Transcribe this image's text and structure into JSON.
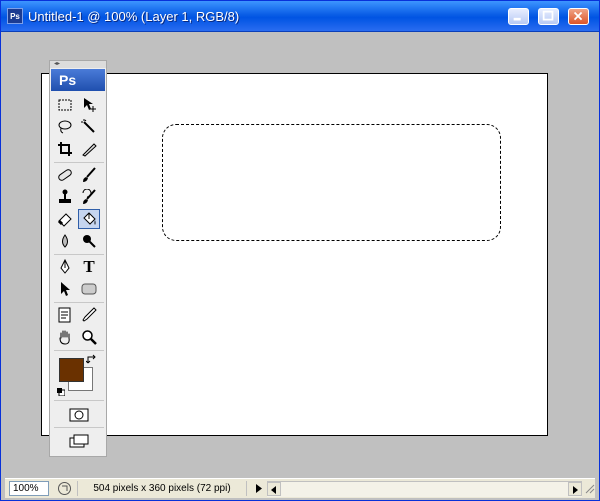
{
  "window": {
    "title": "Untitled-1 @ 100% (Layer 1, RGB/8)",
    "icon": "photoshop-icon",
    "icon_text": "Ps",
    "buttons": [
      "minimize-icon",
      "maximize-icon",
      "close-icon"
    ]
  },
  "toolbox": {
    "logo": "Ps",
    "tools": [
      {
        "name": "rectangular-marquee-tool",
        "icon": "marquee-icon"
      },
      {
        "name": "move-tool",
        "icon": "move-icon"
      },
      {
        "name": "lasso-tool",
        "icon": "lasso-icon"
      },
      {
        "name": "magic-wand-tool",
        "icon": "magic-wand-icon"
      },
      {
        "name": "crop-tool",
        "icon": "crop-icon"
      },
      {
        "name": "slice-tool",
        "icon": "slice-icon"
      },
      {
        "name": "healing-brush-tool",
        "icon": "bandage-icon"
      },
      {
        "name": "brush-tool",
        "icon": "brush-icon"
      },
      {
        "name": "clone-stamp-tool",
        "icon": "stamp-icon"
      },
      {
        "name": "history-brush-tool",
        "icon": "history-brush-icon"
      },
      {
        "name": "eraser-tool",
        "icon": "eraser-icon"
      },
      {
        "name": "paint-bucket-tool",
        "icon": "paint-bucket-icon",
        "active": true
      },
      {
        "name": "blur-tool",
        "icon": "blur-drop-icon"
      },
      {
        "name": "dodge-tool",
        "icon": "dodge-icon"
      },
      {
        "name": "pen-tool",
        "icon": "pen-icon"
      },
      {
        "name": "type-tool",
        "icon": "type-icon",
        "label": "T"
      },
      {
        "name": "path-selection-tool",
        "icon": "arrow-pointer-icon"
      },
      {
        "name": "shape-tool",
        "icon": "rounded-rectangle-icon"
      },
      {
        "name": "notes-tool",
        "icon": "notes-icon"
      },
      {
        "name": "eyedropper-tool",
        "icon": "eyedropper-icon"
      },
      {
        "name": "hand-tool",
        "icon": "hand-icon"
      },
      {
        "name": "zoom-tool",
        "icon": "magnifier-icon"
      }
    ],
    "foreground_color": "#6a3100",
    "background_color": "#ffffff"
  },
  "canvas": {
    "background": "#ffffff",
    "selection": "rounded-rectangle-marquee"
  },
  "status": {
    "zoom": "100%",
    "doc_info": "504 pixels x 360 pixels (72 ppi)"
  }
}
